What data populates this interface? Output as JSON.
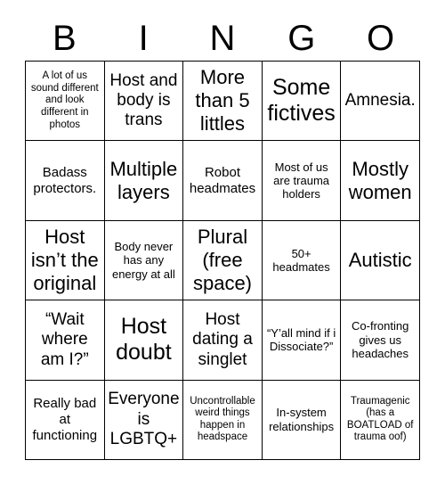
{
  "card": {
    "title": "BINGO",
    "header_letters": [
      "B",
      "I",
      "N",
      "G",
      "O"
    ],
    "columns": 5,
    "rows": 5,
    "border_color": "#000000",
    "cell_background": "#ffffff",
    "text_color": "#000000",
    "free_space_index": 12,
    "cells": [
      {
        "text": "A lot of us sound different and look different in photos",
        "size": "xxs"
      },
      {
        "text": "Host and body is trans",
        "size": "md"
      },
      {
        "text": "More than 5 littles",
        "size": "lg"
      },
      {
        "text": "Some fictives",
        "size": "xl"
      },
      {
        "text": "Amnesia.",
        "size": "md"
      },
      {
        "text": "Badass protectors.",
        "size": "sm"
      },
      {
        "text": "Multiple layers",
        "size": "lg"
      },
      {
        "text": "Robot headmates",
        "size": "sm"
      },
      {
        "text": "Most of us are trauma holders",
        "size": "xs"
      },
      {
        "text": "Mostly women",
        "size": "lg"
      },
      {
        "text": "Host isn’t the original",
        "size": "lg"
      },
      {
        "text": "Body never has any energy at all",
        "size": "xs"
      },
      {
        "text": "Plural (free space)",
        "size": "lg"
      },
      {
        "text": "50+ headmates",
        "size": "xs"
      },
      {
        "text": "Autistic",
        "size": "lg"
      },
      {
        "text": "“Wait where am I?”",
        "size": "md"
      },
      {
        "text": "Host doubt",
        "size": "xl"
      },
      {
        "text": "Host dating a singlet",
        "size": "md"
      },
      {
        "text": "“Y’all mind if i Dissociate?”",
        "size": "xs"
      },
      {
        "text": "Co-fronting gives us headaches",
        "size": "xs"
      },
      {
        "text": "Really bad at functioning",
        "size": "sm"
      },
      {
        "text": "Everyone is LGBTQ+",
        "size": "md"
      },
      {
        "text": "Uncontrollable weird things happen in headspace",
        "size": "xxs"
      },
      {
        "text": "In-system relationships",
        "size": "xs"
      },
      {
        "text": "Traumagenic (has a BOATLOAD of trauma oof)",
        "size": "xxs"
      }
    ]
  }
}
